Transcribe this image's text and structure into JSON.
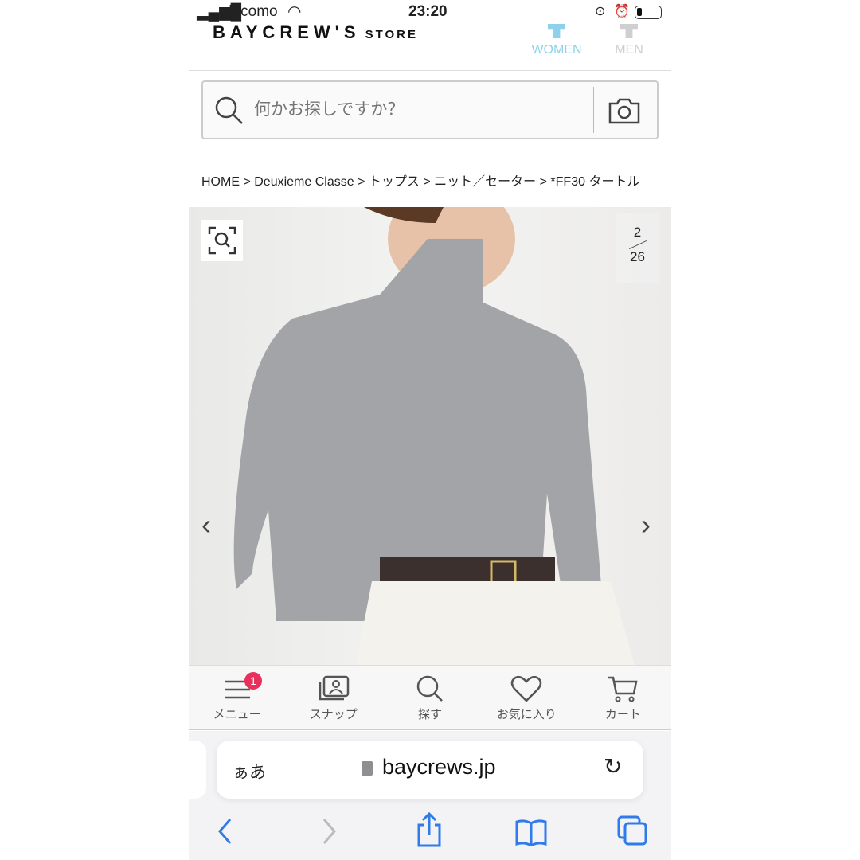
{
  "status": {
    "carrier": "docomo",
    "time": "23:20"
  },
  "header": {
    "logo": "BAYCREW'S",
    "logo_suffix": "STORE",
    "women": "WOMEN",
    "men": "MEN",
    "women_color": "#8fd0ea",
    "men_color": "#cfcfcf"
  },
  "search": {
    "placeholder": "何かお探しですか？"
  },
  "breadcrumb": [
    "HOME",
    ">",
    "Deuxieme Classe",
    ">",
    "トップス",
    ">",
    "ニット／セーター",
    ">",
    "*FF30 タートル"
  ],
  "gallery": {
    "current": "2",
    "total": "26"
  },
  "bottom_nav": {
    "items": [
      {
        "label": "メニュー",
        "icon": "menu-icon",
        "badge": "1"
      },
      {
        "label": "スナップ",
        "icon": "snap-icon"
      },
      {
        "label": "探す",
        "icon": "search-icon"
      },
      {
        "label": "お気に入り",
        "icon": "heart-icon"
      },
      {
        "label": "カート",
        "icon": "cart-icon"
      }
    ]
  },
  "browser": {
    "text_size": "ぁあ",
    "url": "baycrews.jp",
    "accent": "#2f7bea"
  }
}
